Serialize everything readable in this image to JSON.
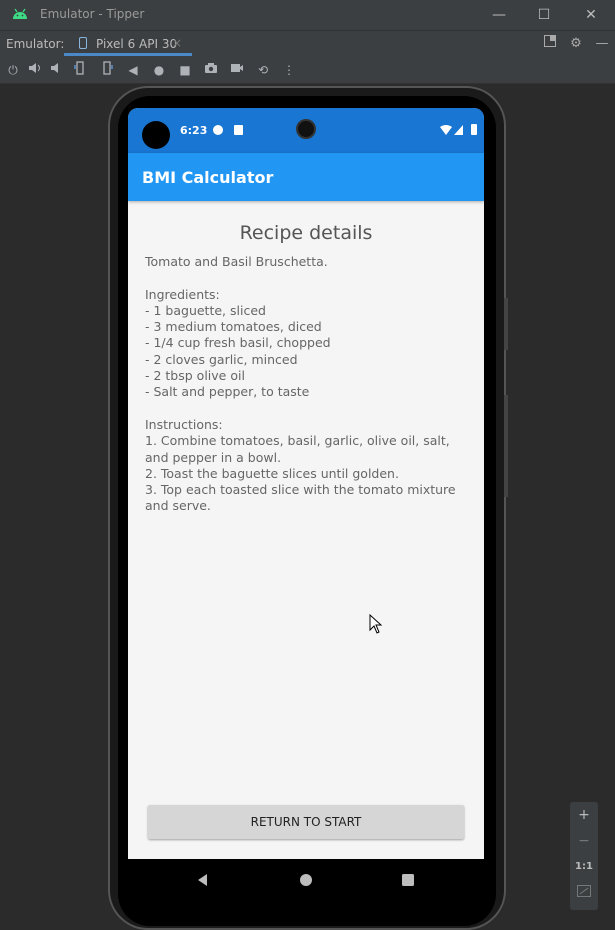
{
  "window": {
    "title": "Emulator - Tipper",
    "controls": {
      "minimize": "—",
      "maximize": "☐",
      "close": "✕"
    }
  },
  "tabbar": {
    "label": "Emulator:",
    "tab_name": "Pixel 6 API 30",
    "tab_close": "×"
  },
  "toolbar": {
    "icons": [
      "power-icon",
      "volume-up-icon",
      "volume-down-icon",
      "rotate-left-icon",
      "rotate-right-icon",
      "back-icon",
      "home-icon",
      "overview-icon",
      "screenshot-icon",
      "record-icon",
      "reset-icon",
      "more-icon"
    ]
  },
  "device": {
    "status": {
      "time": "6:23"
    },
    "app_title": "BMI Calculator",
    "heading": "Recipe details",
    "recipe_text": "Tomato and Basil Bruschetta.\n\nIngredients:\n- 1 baguette, sliced\n- 3 medium tomatoes, diced\n- 1/4 cup fresh basil, chopped\n- 2 cloves garlic, minced\n- 2 tbsp olive oil\n- Salt and pepper, to taste\n\nInstructions:\n1. Combine tomatoes, basil, garlic, olive oil, salt, and pepper in a bowl.\n2. Toast the baguette slices until golden.\n3. Top each toasted slice with the tomato mixture and serve.",
    "button_label": "RETURN TO START"
  },
  "zoom": {
    "zoom_in": "+",
    "zoom_out": "−",
    "actual_size": "1:1"
  },
  "colors": {
    "status_bar": "#1976d2",
    "app_bar": "#2196f3",
    "ide_bg": "#3c3f41",
    "tab_accent": "#4a88c7"
  }
}
